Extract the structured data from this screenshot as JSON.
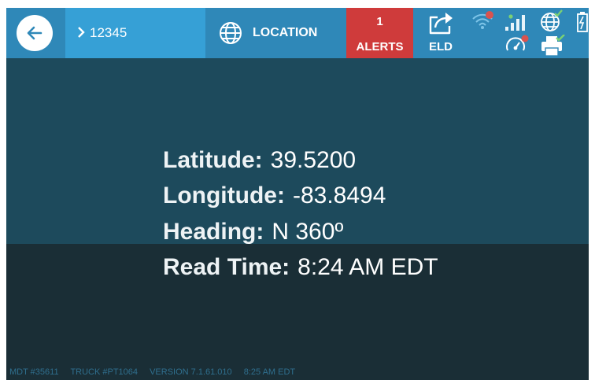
{
  "topbar": {
    "truck_id": "12345",
    "location_label": "LOCATION",
    "alerts_count": "1",
    "alerts_label": "ALERTS",
    "eld_label": "ELD",
    "status_icons": [
      "wifi-off-icon",
      "signal-bars-icon",
      "globe-check-icon",
      "battery-icon",
      "engine-error-icon",
      "printer-check-icon"
    ]
  },
  "location": {
    "latitude_label": "Latitude:",
    "latitude_value": "39.5200",
    "longitude_label": "Longitude:",
    "longitude_value": "-83.8494",
    "heading_label": "Heading:",
    "heading_value": "N 360º",
    "read_time_label": "Read Time:",
    "read_time_value": "8:24 AM EDT"
  },
  "footer": {
    "mdt": "MDT #35611",
    "truck": "TRUCK #PT1064",
    "version": "VERSION  7.1.61.010",
    "time": "8:25 AM EDT"
  },
  "colors": {
    "topbar": "#2f88b8",
    "truck_tab": "#36a0d6",
    "alerts": "#cf3b3b",
    "background": "#1b3946"
  }
}
